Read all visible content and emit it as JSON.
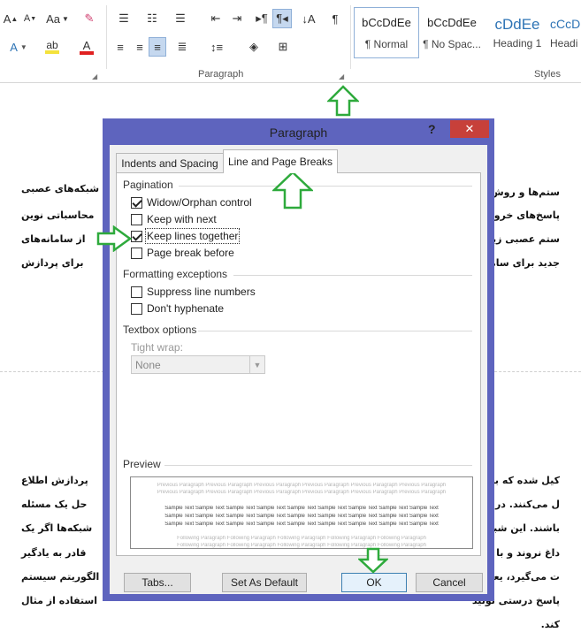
{
  "ribbon": {
    "font_tools": {
      "grow_font": "A",
      "shrink_font": "A",
      "change_case": "Aa",
      "font_color_letter": "A",
      "text_effects_letter": "A"
    },
    "paragraph_label": "Paragraph",
    "styles_label": "Styles",
    "styles": [
      {
        "preview": "bCcDdEe",
        "name": "¶ Normal"
      },
      {
        "preview": "bCcDdEe",
        "name": "¶ No Spac..."
      },
      {
        "preview": "cDdEe",
        "name": "Heading 1"
      },
      {
        "preview": "cCcD",
        "name": "Headi"
      }
    ],
    "colors": {
      "highlight": "#f4e23c",
      "font_color": "#e02020",
      "heading_blue": "#2e74b5"
    }
  },
  "document": {
    "page1_lines": [
      "شبکه‌های عصبی",
      "محاسباتی نوین",
      "از سامانه‌های",
      "برای پردازش"
    ],
    "page1_lines_right": [
      "ستم‌ها و روش‌های",
      "پاسخ‌های خروجی",
      "ستم عصبی زیستی،",
      "جدید برای سامانه"
    ],
    "page2_lines": [
      "پردازش اطلاع",
      "حل یک مسئله",
      "شبکه‌ها اگر یک",
      "قادر به یادگیر",
      "الگوریتم سیستم",
      "استفاده از مثال",
      ""
    ],
    "page2_lines_right": [
      "کیل شده که برای",
      "ل می‌کنند. در این",
      "باشند. این شبکه‌ها",
      "داغ نروند و با این",
      "ت می‌گیرد، یعنی با",
      "پاسخ درستی تولید",
      "کند."
    ]
  },
  "dialog": {
    "title": "Paragraph",
    "help": "?",
    "close": "✕",
    "tabs": [
      "Indents and Spacing",
      "Line and Page Breaks"
    ],
    "active_tab": "Line and Page Breaks",
    "sections": {
      "pagination": "Pagination",
      "formatting_exceptions": "Formatting exceptions",
      "textbox_options": "Textbox options",
      "preview": "Preview"
    },
    "pagination_options": [
      {
        "label": "Widow/Orphan control",
        "checked": true
      },
      {
        "label": "Keep with next",
        "checked": false
      },
      {
        "label": "Keep lines together",
        "checked": true
      },
      {
        "label": "Page break before",
        "checked": false
      }
    ],
    "formatting_options": [
      {
        "label": "Suppress line numbers",
        "checked": false
      },
      {
        "label": "Don't hyphenate",
        "checked": false
      }
    ],
    "tight_wrap": {
      "label": "Tight wrap:",
      "value": "None"
    },
    "preview_text": {
      "previous": "Previous Paragraph Previous Paragraph Previous Paragraph Previous Paragraph Previous Paragraph Previous Paragraph",
      "sample": "Sample Text Sample Text Sample Text Sample Text Sample Text Sample Text Sample Text Sample Text Sample Text",
      "following": "Following Paragraph Following Paragraph Following Paragraph Following Paragraph Following Paragraph"
    },
    "buttons": {
      "tabs": "Tabs...",
      "set_default": "Set As Default",
      "ok": "OK",
      "cancel": "Cancel"
    }
  },
  "annotations": {
    "arrow_color": "#2eaa3c"
  }
}
